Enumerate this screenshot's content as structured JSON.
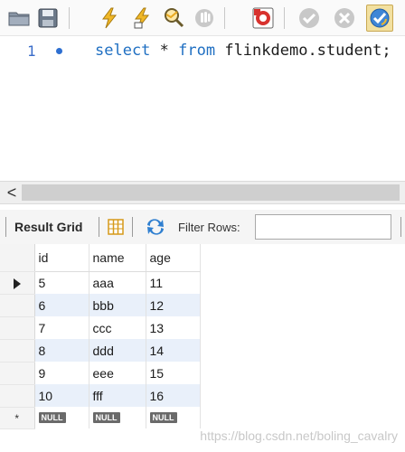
{
  "toolbar": {
    "buttons": [
      {
        "name": "open-folder-icon"
      },
      {
        "name": "save-icon"
      },
      {
        "name": "execute-icon"
      },
      {
        "name": "execute-current-icon"
      },
      {
        "name": "explain-icon"
      },
      {
        "name": "stop-icon"
      },
      {
        "name": "error-toggle-icon"
      },
      {
        "name": "commit-icon"
      },
      {
        "name": "rollback-icon"
      },
      {
        "name": "autocommit-icon"
      }
    ],
    "colors": {
      "accent": "#e8a820",
      "primary": "#1f6fc2"
    }
  },
  "editor": {
    "line_number": "1",
    "code": {
      "kw1": "select",
      "mid": " * ",
      "kw2": "from",
      "rest": " flinkdemo.student;"
    }
  },
  "scrollbar": {
    "left_arrow": "<"
  },
  "result_bar": {
    "result_grid_label": "Result Grid",
    "filter_label": "Filter Rows:",
    "filter_value": ""
  },
  "grid": {
    "columns": [
      "id",
      "name",
      "age"
    ],
    "rows": [
      {
        "id": "5",
        "name": "aaa",
        "age": "11"
      },
      {
        "id": "6",
        "name": "bbb",
        "age": "12"
      },
      {
        "id": "7",
        "name": "ccc",
        "age": "13"
      },
      {
        "id": "8",
        "name": "ddd",
        "age": "14"
      },
      {
        "id": "9",
        "name": "eee",
        "age": "15"
      },
      {
        "id": "10",
        "name": "fff",
        "age": "16"
      }
    ],
    "null_label": "NULL",
    "new_row_marker": "*"
  },
  "watermark": "https://blog.csdn.net/boling_cavalry"
}
